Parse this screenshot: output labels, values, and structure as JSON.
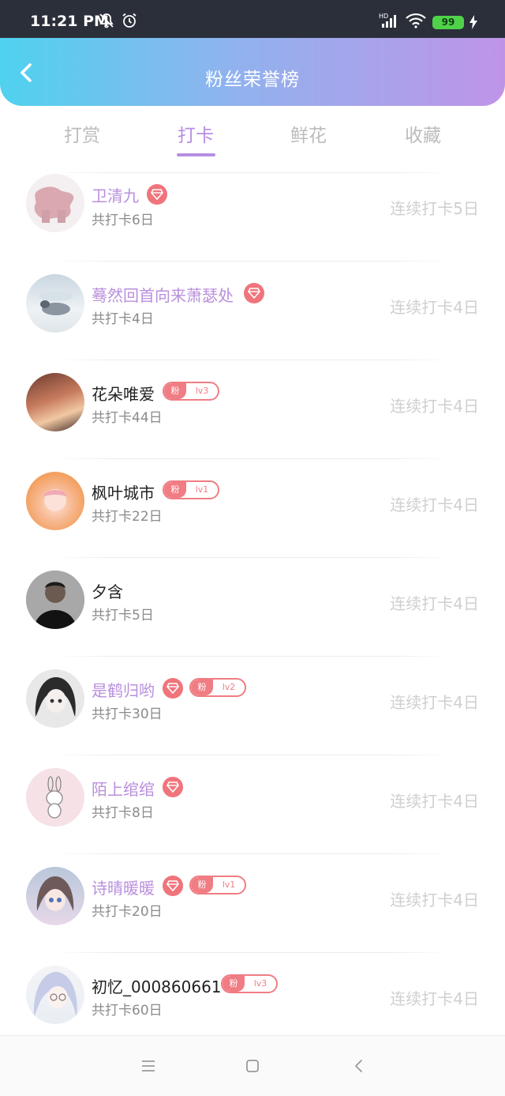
{
  "status_bar": {
    "time": "11:21 PM",
    "battery": "99"
  },
  "header": {
    "title": "粉丝荣誉榜"
  },
  "tabs": [
    {
      "label": "打赏",
      "active": false
    },
    {
      "label": "打卡",
      "active": true
    },
    {
      "label": "鲜花",
      "active": false
    },
    {
      "label": "收藏",
      "active": false
    }
  ],
  "fans": [
    {
      "name": "卫清九",
      "vip": true,
      "gem": true,
      "badge": null,
      "total": "共打卡6日",
      "streak": "连续打卡5日"
    },
    {
      "name": "蓦然回首向来萧瑟处",
      "vip": true,
      "gem": true,
      "badge": null,
      "total": "共打卡4日",
      "streak": "连续打卡4日"
    },
    {
      "name": "花朵唯爱",
      "vip": false,
      "gem": false,
      "badge": {
        "fan": "粉",
        "level": "lv3"
      },
      "total": "共打卡44日",
      "streak": "连续打卡4日"
    },
    {
      "name": "枫叶城市",
      "vip": false,
      "gem": false,
      "badge": {
        "fan": "粉",
        "level": "lv1"
      },
      "total": "共打卡22日",
      "streak": "连续打卡4日"
    },
    {
      "name": "夕含",
      "vip": false,
      "gem": false,
      "badge": null,
      "total": "共打卡5日",
      "streak": "连续打卡4日"
    },
    {
      "name": "是鹤归哟",
      "vip": true,
      "gem": true,
      "badge": {
        "fan": "粉",
        "level": "lv2"
      },
      "total": "共打卡30日",
      "streak": "连续打卡4日"
    },
    {
      "name": "陌上绾绾",
      "vip": true,
      "gem": true,
      "badge": null,
      "total": "共打卡8日",
      "streak": "连续打卡4日"
    },
    {
      "name": "诗晴暖暖",
      "vip": true,
      "gem": true,
      "badge": {
        "fan": "粉",
        "level": "lv1"
      },
      "total": "共打卡20日",
      "streak": "连续打卡4日"
    },
    {
      "name": "初忆_000860661",
      "vip": false,
      "gem": false,
      "badge": {
        "fan": "粉",
        "level": "lv3"
      },
      "total": "共打卡60日",
      "streak": "连续打卡4日"
    }
  ],
  "colors": {
    "accent": "#b78ee1",
    "vip_name": "#b98fdc",
    "badge": "#f07d84",
    "header_gradient": [
      "#4fd2ef",
      "#bf94e8"
    ]
  },
  "icons": {
    "status": [
      "mute-bell-icon",
      "alarm-icon",
      "signal-icon",
      "wifi-icon",
      "battery-icon",
      "charging-icon"
    ],
    "header": "back-chevron-icon",
    "navbar": [
      "menu-icon",
      "home-square-icon",
      "back-triangle-icon"
    ]
  }
}
